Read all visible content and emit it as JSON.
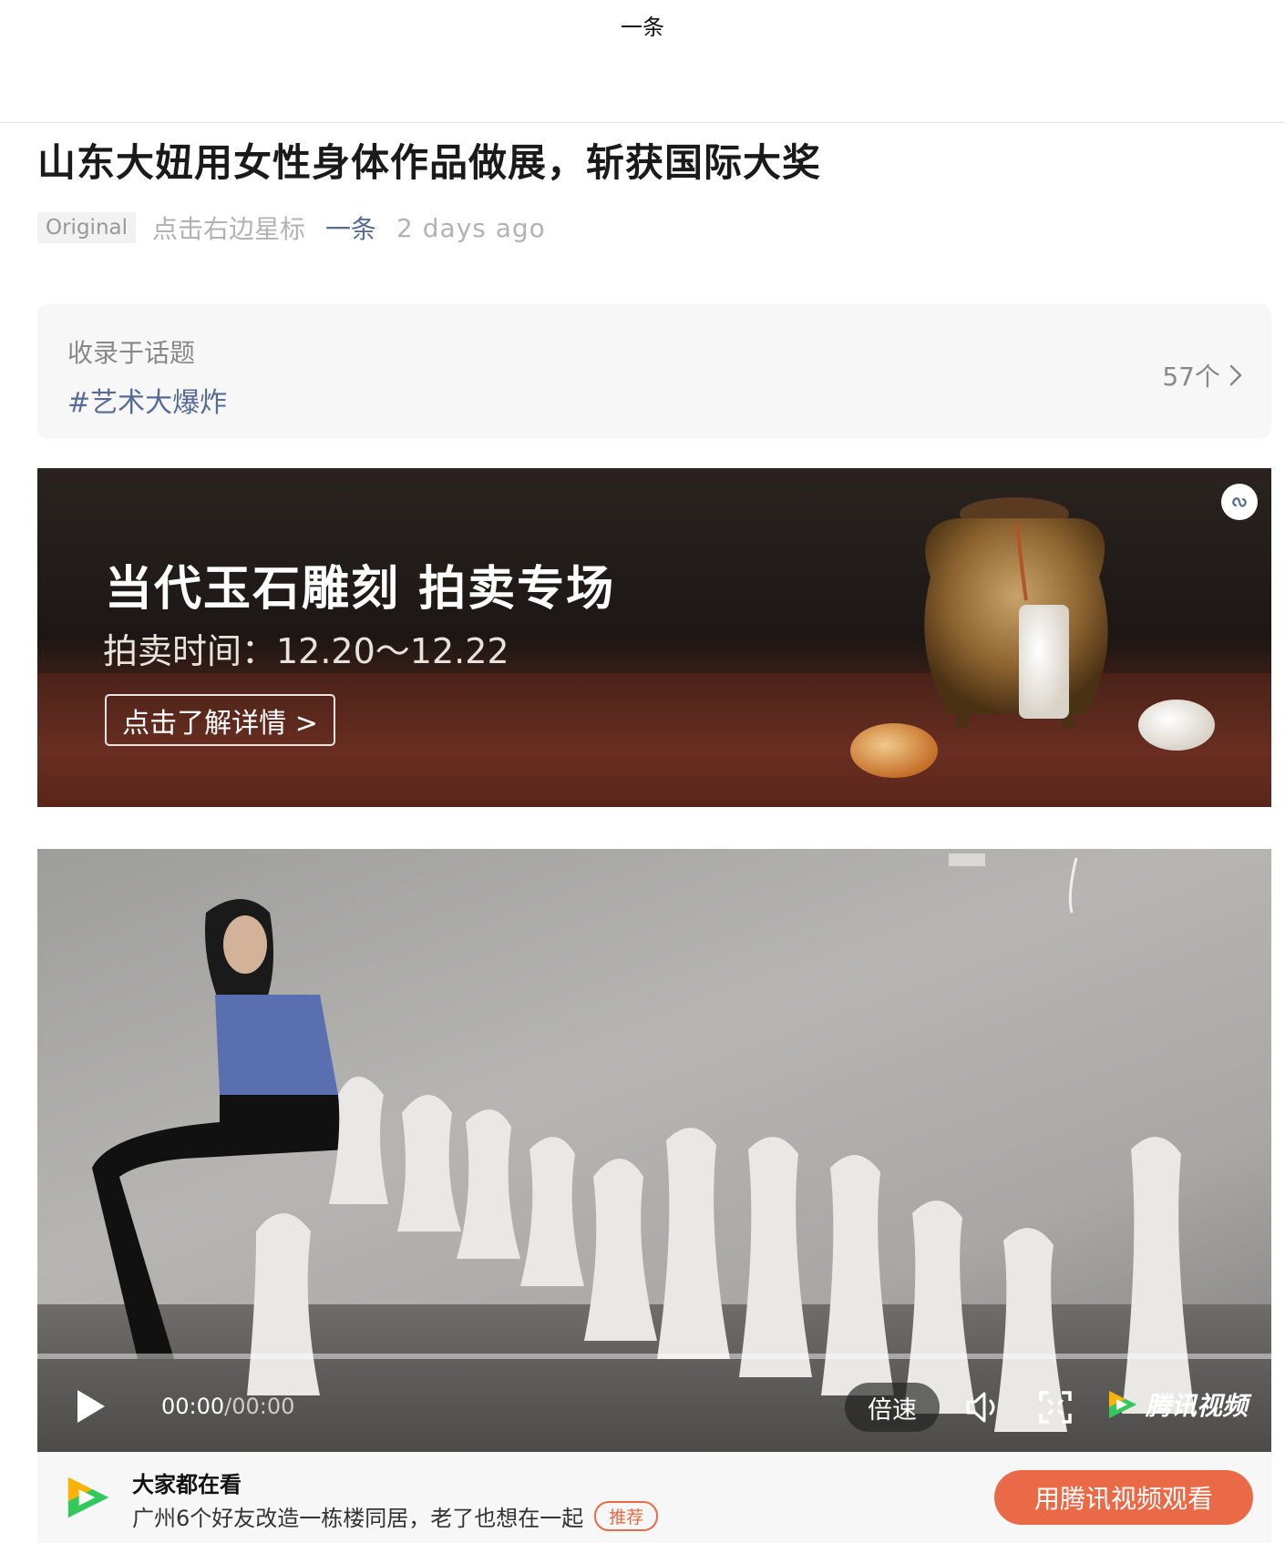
{
  "topbar": {
    "title": "一条"
  },
  "article": {
    "title": "山东大妞用女性身体作品做展，斩获国际大奖",
    "original_badge": "Original",
    "star_hint": "点击右边星标",
    "author": "一条",
    "time": "2 days ago"
  },
  "topic": {
    "label": "收录于话题",
    "tag": "#艺术大爆炸",
    "count": "57个"
  },
  "banner": {
    "headline": "当代玉石雕刻 拍卖专场",
    "time": "拍卖时间：12.20～12.22",
    "button": "点击了解详情 >"
  },
  "video": {
    "current_time": "00:00",
    "separator": "/",
    "duration": "00:00",
    "speed_label": "倍速",
    "brand": "腾讯视频",
    "progress": 0
  },
  "recommend": {
    "heading": "大家都在看",
    "text": "广州6个好友改造一栋楼同居，老了也想在一起",
    "badge": "推荐",
    "button": "用腾讯视频观看"
  },
  "colors": {
    "link": "#576b95",
    "accent": "#ea6946",
    "muted": "#b2b2b2"
  },
  "icons": [
    "chevron-right-icon",
    "mini-program-icon",
    "play-icon",
    "volume-icon",
    "fullscreen-icon",
    "tencent-video-icon"
  ]
}
